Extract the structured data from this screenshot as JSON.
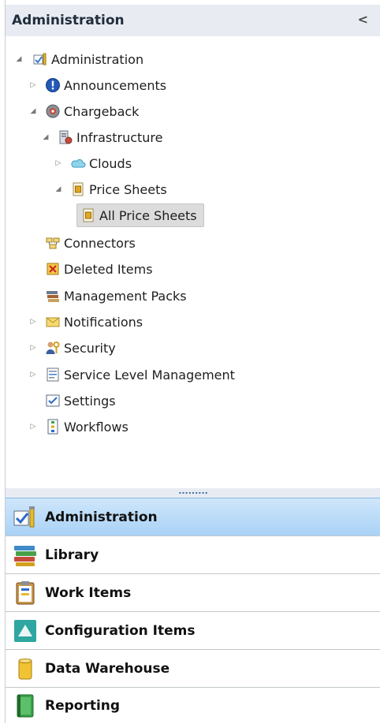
{
  "header": {
    "title": "Administration",
    "collapse_glyph": "<"
  },
  "tree": [
    {
      "label": "Administration",
      "icon": "administration-icon",
      "expander": "expanded"
    },
    {
      "label": "Announcements",
      "icon": "announcements-icon",
      "expander": "collapsed"
    },
    {
      "label": "Chargeback",
      "icon": "chargeback-icon",
      "expander": "expanded"
    },
    {
      "label": "Infrastructure",
      "icon": "infrastructure-icon",
      "expander": "expanded"
    },
    {
      "label": "Clouds",
      "icon": "cloud-icon",
      "expander": "collapsed"
    },
    {
      "label": "Price Sheets",
      "icon": "price-sheet-icon",
      "expander": "expanded"
    },
    {
      "label": "All Price Sheets",
      "icon": "price-sheet-icon",
      "expander": "none",
      "selected": true
    },
    {
      "label": "Connectors",
      "icon": "connectors-icon",
      "expander": "none"
    },
    {
      "label": "Deleted Items",
      "icon": "deleted-items-icon",
      "expander": "none"
    },
    {
      "label": "Management Packs",
      "icon": "management-packs-icon",
      "expander": "none"
    },
    {
      "label": "Notifications",
      "icon": "notifications-icon",
      "expander": "collapsed"
    },
    {
      "label": "Security",
      "icon": "security-icon",
      "expander": "collapsed"
    },
    {
      "label": "Service Level Management",
      "icon": "service-level-icon",
      "expander": "collapsed"
    },
    {
      "label": "Settings",
      "icon": "settings-icon",
      "expander": "none"
    },
    {
      "label": "Workflows",
      "icon": "workflows-icon",
      "expander": "collapsed"
    }
  ],
  "splitter": {
    "glyph": "........."
  },
  "nav": [
    {
      "label": "Administration",
      "icon": "administration-nav-icon",
      "active": true
    },
    {
      "label": "Library",
      "icon": "library-icon",
      "active": false
    },
    {
      "label": "Work Items",
      "icon": "work-items-icon",
      "active": false
    },
    {
      "label": "Configuration Items",
      "icon": "configuration-items-icon",
      "active": false
    },
    {
      "label": "Data Warehouse",
      "icon": "data-warehouse-icon",
      "active": false
    },
    {
      "label": "Reporting",
      "icon": "reporting-icon",
      "active": false
    }
  ],
  "colors": {
    "accent": "#a9d2f6",
    "header_bg": "#e8ecf2",
    "selection_bg": "#dcdcdc"
  }
}
